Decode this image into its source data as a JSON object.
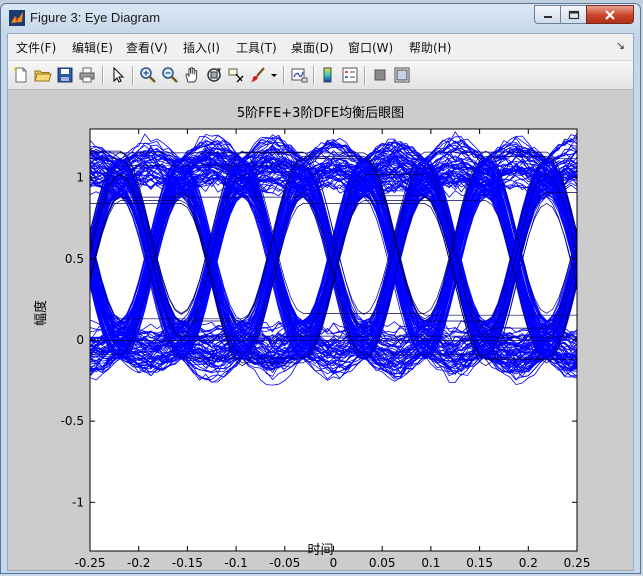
{
  "window": {
    "title": "Figure 3: Eye Diagram",
    "minimize_glyph": "",
    "maximize_glyph": "",
    "close_glyph": ""
  },
  "menubar": {
    "items": [
      {
        "label": "文件(F)"
      },
      {
        "label": "编辑(E)"
      },
      {
        "label": "查看(V)"
      },
      {
        "label": "插入(I)"
      },
      {
        "label": "工具(T)"
      },
      {
        "label": "桌面(D)"
      },
      {
        "label": "窗口(W)"
      },
      {
        "label": "帮助(H)"
      }
    ],
    "dock_glyph": "↘"
  },
  "toolbar": {
    "icons": [
      "new-file-icon",
      "open-file-icon",
      "save-icon",
      "print-icon",
      "pointer-icon",
      "zoom-in-icon",
      "zoom-out-icon",
      "pan-hand-icon",
      "rotate-3d-icon",
      "data-cursor-icon",
      "brush-icon",
      "dropdown-icon",
      "link-plot-icon",
      "colorbar-icon",
      "legend-icon",
      "hide-plot-tools-icon",
      "show-plot-tools-icon"
    ]
  },
  "colors": {
    "trace": "#0000ff",
    "axes_bg": "#ffffff",
    "figure_bg": "#cccccc"
  },
  "chart_data": {
    "type": "line",
    "title": "5阶FFE+3阶DFE均衡后眼图",
    "xlabel": "时间",
    "ylabel": "幅度",
    "xlim": [
      -0.25,
      0.25
    ],
    "ylim": [
      -1.3,
      1.3
    ],
    "xticks": [
      "-0.25",
      "-0.2",
      "-0.15",
      "-0.1",
      "-0.05",
      "0",
      "0.05",
      "0.1",
      "0.15",
      "0.2",
      "0.25"
    ],
    "yticks": [
      "-1",
      "-0.5",
      "0",
      "0.5",
      "1"
    ],
    "ytick_values": [
      -1,
      -0.5,
      0,
      0.5,
      1
    ],
    "xtick_values": [
      -0.25,
      -0.2,
      -0.15,
      -0.1,
      -0.05,
      0,
      0.05,
      0.1,
      0.15,
      0.2,
      0.25
    ],
    "levels": [
      0,
      1
    ],
    "symbol_period": 0.0625,
    "crossing_times": [
      -0.1875,
      -0.125,
      -0.0625,
      0,
      0.0625,
      0.125,
      0.1875
    ],
    "crossing_level": 0.5,
    "noise_band": 0.15,
    "grid": false
  }
}
